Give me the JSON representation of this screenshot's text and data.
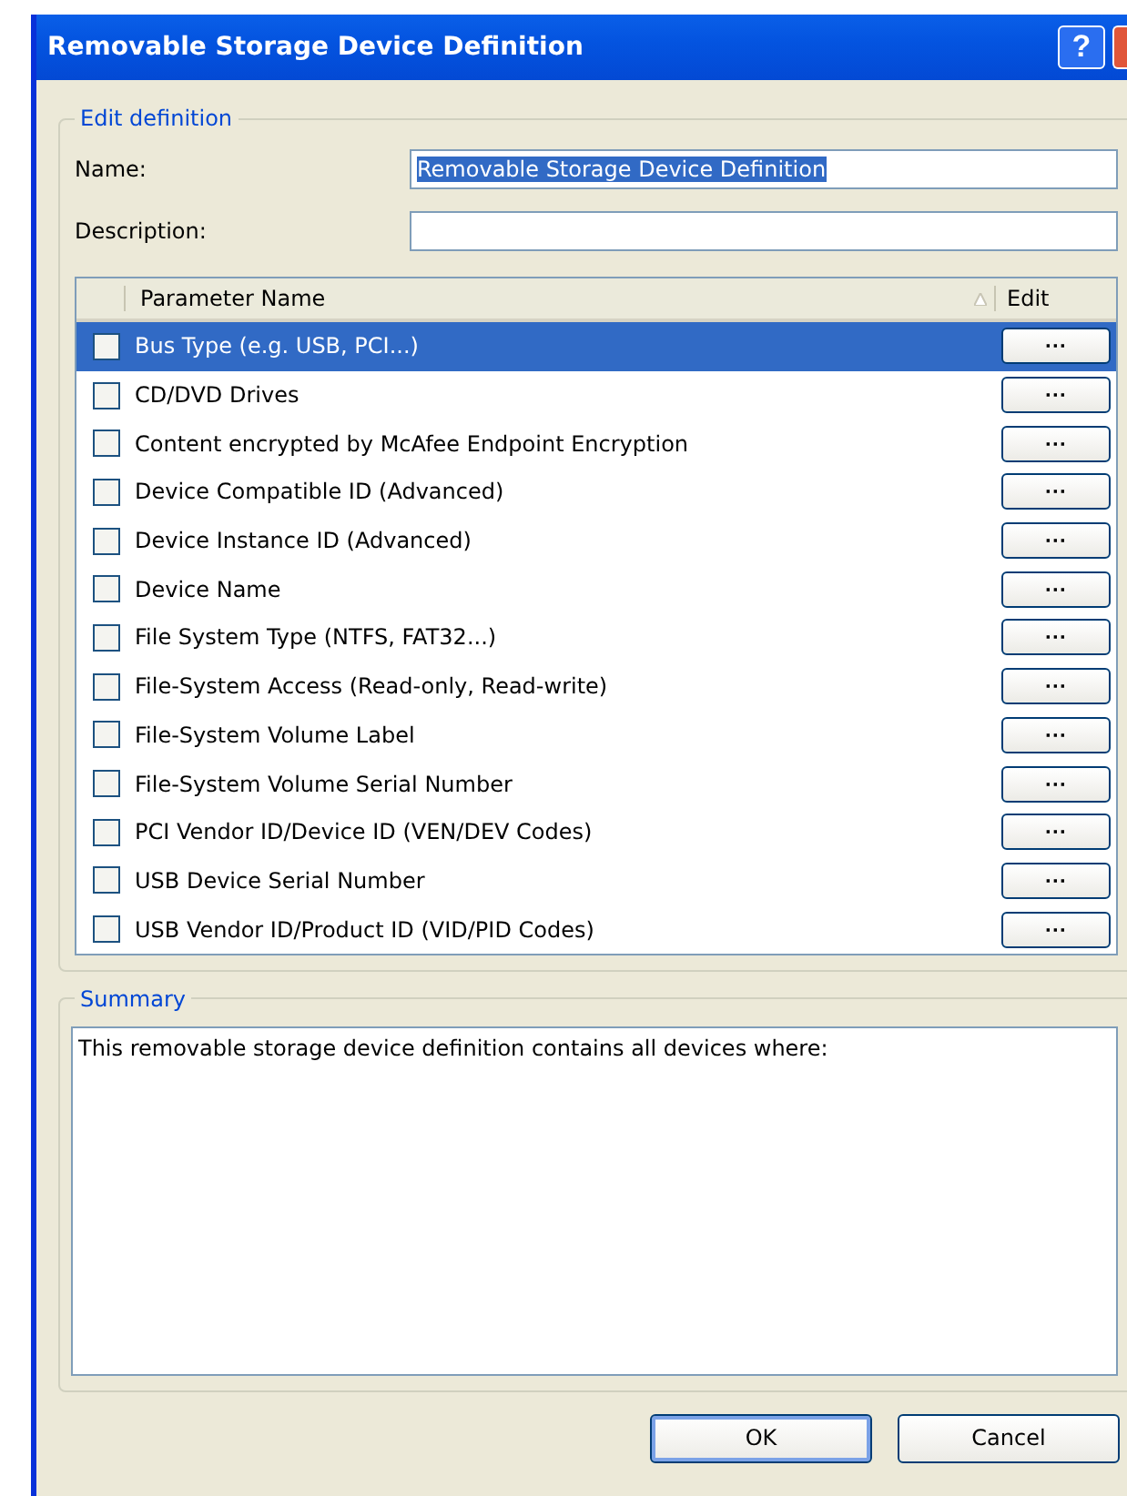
{
  "window": {
    "title": "Removable Storage Device Definition"
  },
  "edit_definition": {
    "legend": "Edit definition",
    "name_label": "Name:",
    "name_value": "Removable Storage Device Definition",
    "name_value_selected": true,
    "description_label": "Description:",
    "table": {
      "columns": [
        "Parameter Name",
        "Edit"
      ],
      "sort_ascending": true,
      "rows": [
        {
          "name": "Bus Type (e.g. USB, PCI...)",
          "checked": false,
          "selected": true,
          "edit": "···"
        },
        {
          "name": "CD/DVD Drives",
          "checked": false,
          "selected": false,
          "edit": "···"
        },
        {
          "name": "Content encrypted by McAfee Endpoint Encryption",
          "checked": false,
          "selected": false,
          "edit": "···"
        },
        {
          "name": "Device Compatible ID (Advanced)",
          "checked": false,
          "selected": false,
          "edit": "···"
        },
        {
          "name": "Device Instance ID (Advanced)",
          "checked": false,
          "selected": false,
          "edit": "···"
        },
        {
          "name": "Device Name",
          "checked": false,
          "selected": false,
          "edit": "···"
        },
        {
          "name": "File System Type (NTFS, FAT32...)",
          "checked": false,
          "selected": false,
          "edit": "···"
        },
        {
          "name": "File-System Access (Read-only, Read-write)",
          "checked": false,
          "selected": false,
          "edit": "···"
        },
        {
          "name": "File-System Volume Label",
          "checked": false,
          "selected": false,
          "edit": "···"
        },
        {
          "name": "File-System Volume Serial Number",
          "checked": false,
          "selected": false,
          "edit": "···"
        },
        {
          "name": "PCI Vendor ID/Device ID (VEN/DEV Codes)",
          "checked": false,
          "selected": false,
          "edit": "···"
        },
        {
          "name": "USB Device Serial Number",
          "checked": false,
          "selected": false,
          "edit": "···"
        },
        {
          "name": "USB Vendor ID/Product ID (VID/PID Codes)",
          "checked": false,
          "selected": false,
          "edit": "···"
        }
      ]
    }
  },
  "summary": {
    "legend": "Summary",
    "text": "This removable storage device definition contains all devices where:"
  },
  "buttons": [
    {
      "label": "OK",
      "default": true
    },
    {
      "label": "Cancel",
      "default": false
    }
  ],
  "title_buttons": [
    "?"
  ]
}
